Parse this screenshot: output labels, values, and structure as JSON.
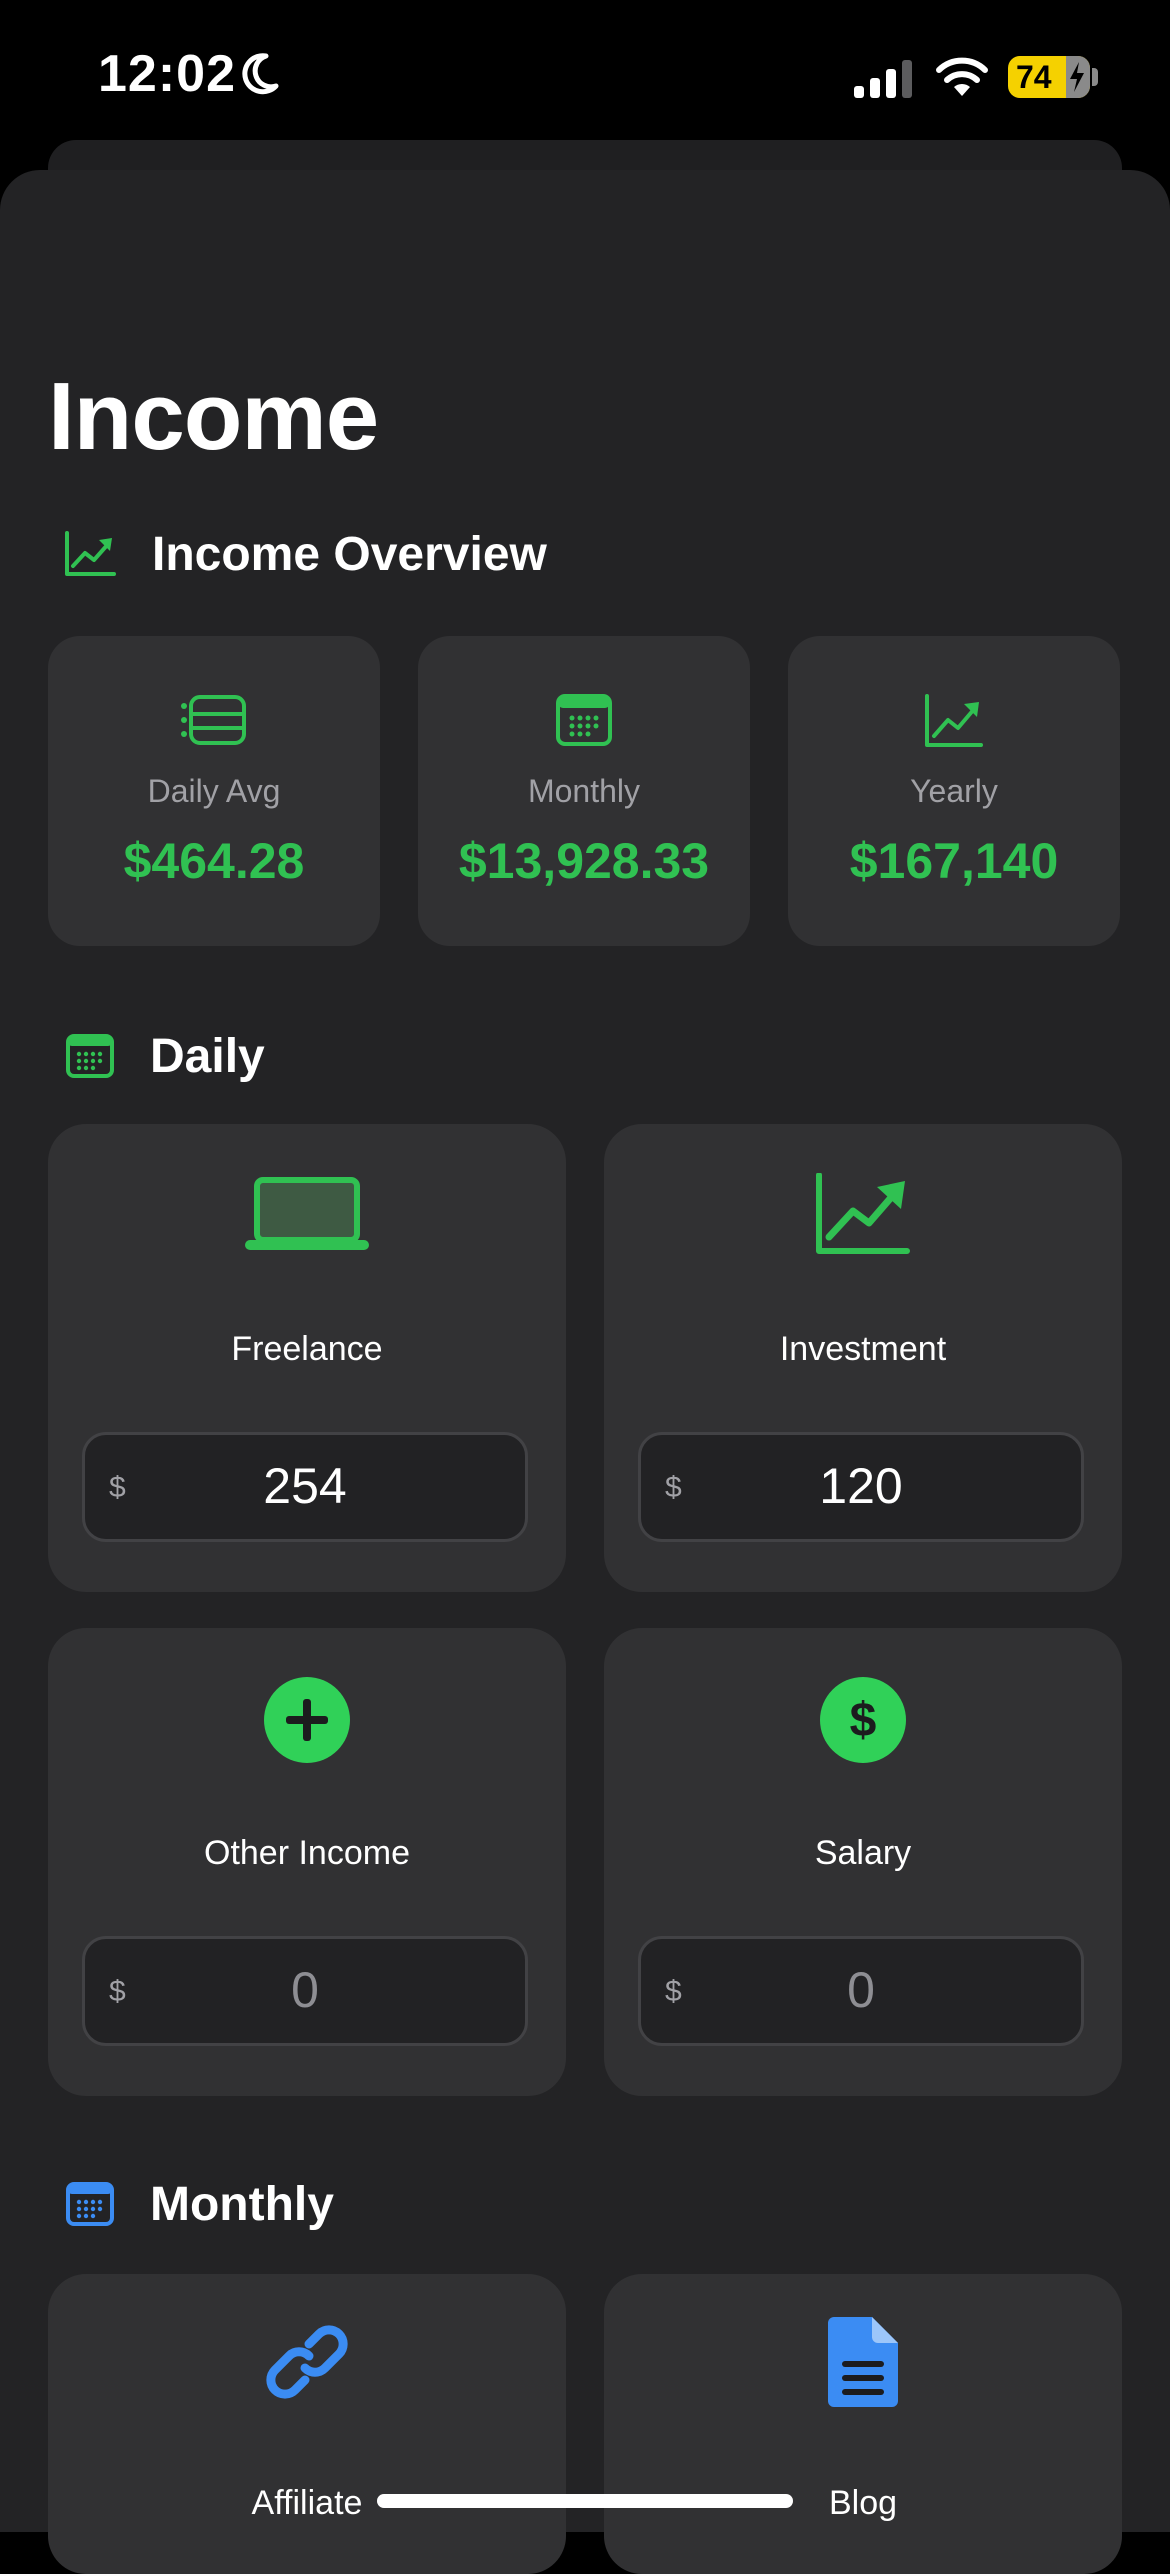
{
  "status": {
    "time": "12:02",
    "battery": "74"
  },
  "page": {
    "title": "Income"
  },
  "overview": {
    "title": "Income Overview",
    "cards": [
      {
        "label": "Daily Avg",
        "value": "$464.28",
        "icon": "list-icon"
      },
      {
        "label": "Monthly",
        "value": "$13,928.33",
        "icon": "calendar-icon"
      },
      {
        "label": "Yearly",
        "value": "$167,140",
        "icon": "chart-line-icon"
      }
    ]
  },
  "daily": {
    "title": "Daily",
    "items": [
      {
        "name": "Freelance",
        "currency": "$",
        "amount": "254",
        "icon": "laptop-icon"
      },
      {
        "name": "Investment",
        "currency": "$",
        "amount": "120",
        "icon": "chart-line-icon"
      },
      {
        "name": "Other Income",
        "currency": "$",
        "amount": "0",
        "icon": "plus-circle-icon"
      },
      {
        "name": "Salary",
        "currency": "$",
        "amount": "0",
        "icon": "dollar-circle-icon"
      }
    ]
  },
  "monthly": {
    "title": "Monthly",
    "items": [
      {
        "name": "Affiliate",
        "icon": "link-icon"
      },
      {
        "name": "Blog",
        "icon": "document-icon"
      }
    ]
  },
  "colors": {
    "accent_green": "#30c152",
    "accent_blue": "#3b8cf3",
    "card": "#313133",
    "background": "#232325"
  }
}
